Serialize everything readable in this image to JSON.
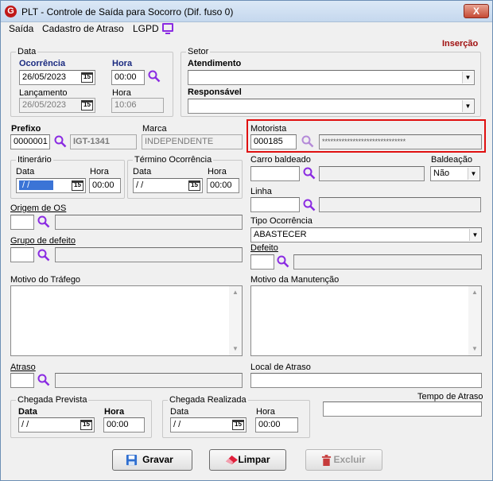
{
  "window": {
    "title": "PLT - Controle de Saída para Socorro (Dif. fuso 0)",
    "close": "X",
    "icon_letter": "G"
  },
  "menu": {
    "items": [
      "Saída",
      "Cadastro de Atraso",
      "LGPD"
    ]
  },
  "mode_label": "Inserção",
  "data_group": {
    "legend": "Data",
    "ocorrencia_label": "Ocorrência",
    "ocorrencia_date": "26/05/2023",
    "hora_label": "Hora",
    "hora_value": "00:00",
    "lancamento_label": "Lançamento",
    "lancamento_date": "26/05/2023",
    "lanc_hora_label": "Hora",
    "lanc_hora_value": "10:06"
  },
  "setor_group": {
    "legend": "Setor",
    "atendimento_label": "Atendimento",
    "atendimento_value": "",
    "responsavel_label": "Responsável",
    "responsavel_value": ""
  },
  "prefixo": {
    "label": "Prefixo",
    "value": "0000001",
    "desc": "IGT-1341"
  },
  "marca": {
    "label": "Marca",
    "value": "INDEPENDENTE"
  },
  "motorista": {
    "label": "Motorista",
    "value": "000185",
    "desc": "******************************"
  },
  "itinerario": {
    "legend": "Itinerário",
    "data_label": "Data",
    "data_value": "/ /",
    "hora_label": "Hora",
    "hora_value": "00:00"
  },
  "termino": {
    "legend": "Término Ocorrência",
    "data_label": "Data",
    "data_value": "/ /",
    "hora_label": "Hora",
    "hora_value": "00:00"
  },
  "carro_baldeado": {
    "label": "Carro baldeado",
    "value": "",
    "desc": ""
  },
  "baldeacao": {
    "label": "Baldeação",
    "value": "Não"
  },
  "linha": {
    "label": "Linha",
    "value": "",
    "desc": ""
  },
  "origem_os": {
    "label": "Origem de OS",
    "value": "",
    "desc": ""
  },
  "tipo_ocorrencia": {
    "label": "Tipo Ocorrência",
    "value": "ABASTECER"
  },
  "grupo_defeito": {
    "label": "Grupo de defeito",
    "value": "",
    "desc": ""
  },
  "defeito": {
    "label": "Defeito",
    "value": "",
    "desc": ""
  },
  "motivo_trafego": {
    "label": "Motivo do Tráfego",
    "value": ""
  },
  "motivo_manutencao": {
    "label": "Motivo da Manutenção",
    "value": ""
  },
  "atraso": {
    "label": "Atraso",
    "value": "",
    "desc": ""
  },
  "local_atraso": {
    "label": "Local de Atraso",
    "value": ""
  },
  "chegada_prevista": {
    "legend": "Chegada Prevista",
    "data_label": "Data",
    "data_value": "/ /",
    "hora_label": "Hora",
    "hora_value": "00:00"
  },
  "chegada_realizada": {
    "legend": "Chegada Realizada",
    "data_label": "Data",
    "data_value": "/ /",
    "hora_label": "Hora",
    "hora_value": "00:00"
  },
  "tempo_atraso": {
    "label": "Tempo de Atraso",
    "value": ""
  },
  "buttons": {
    "gravar": "Gravar",
    "limpar": "Limpar",
    "excluir": "Excluir"
  },
  "calendar_glyph": "15",
  "colors": {
    "accent": "#8a2be2",
    "mode": "#a01010",
    "highlight": "#e01010"
  }
}
